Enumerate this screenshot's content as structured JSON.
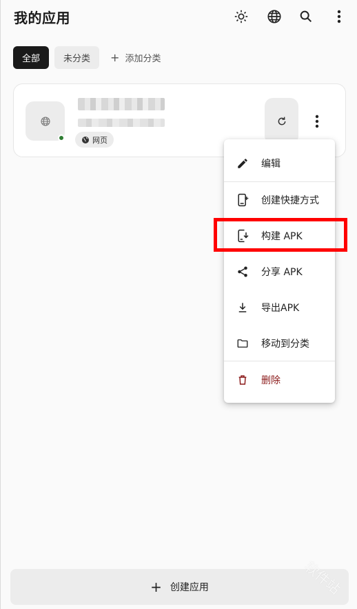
{
  "appbar": {
    "title": "我的应用",
    "icons": [
      "brightness-icon",
      "globe-icon",
      "search-icon",
      "more-vert-icon"
    ]
  },
  "categories": {
    "all": "全部",
    "uncategorized": "未分类",
    "add": "添加分类"
  },
  "app_card": {
    "type_label": "网页",
    "status_color": "#2e7d32"
  },
  "menu": {
    "items": [
      {
        "label": "编辑",
        "icon": "edit-icon"
      },
      {
        "label": "创建快捷方式",
        "icon": "add-shortcut-icon"
      },
      {
        "label": "构建 APK",
        "icon": "build-apk-icon"
      },
      {
        "label": "分享 APK",
        "icon": "share-icon"
      },
      {
        "label": "导出APK",
        "icon": "download-icon"
      },
      {
        "label": "移动到分类",
        "icon": "folder-icon"
      },
      {
        "label": "删除",
        "icon": "delete-icon"
      }
    ],
    "danger_color": "#8b1a1a"
  },
  "footer": {
    "create_label": "创建应用"
  },
  "watermark": "软件站",
  "colors": {
    "highlight": "#ff0000",
    "chip_active": "#1a1a1a"
  }
}
